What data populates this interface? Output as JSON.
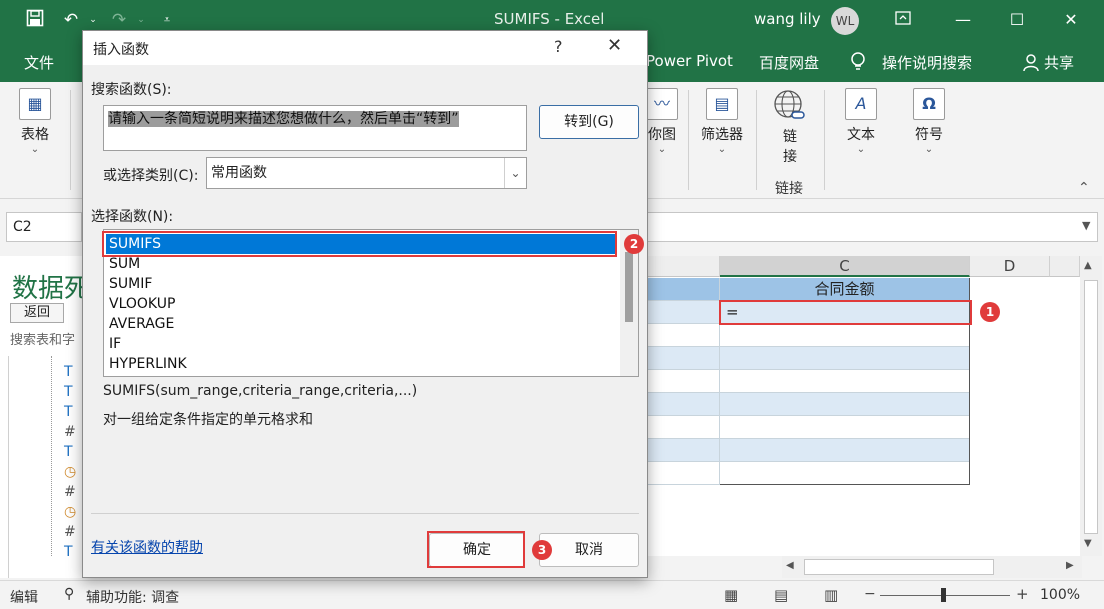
{
  "window": {
    "title": "SUMIFS  -  Excel",
    "user_name": "wang lily",
    "avatar_initials": "WL"
  },
  "ribbon_tabs": [
    {
      "label": "文件"
    },
    {
      "label": "Power Pivot"
    },
    {
      "label": "百度网盘"
    },
    {
      "label": "操作说明搜索"
    },
    {
      "label": "共享"
    }
  ],
  "ribbon": {
    "table_label": "表格",
    "chart_label": "你图",
    "filter_label": "筛选器",
    "link_label_1": "链",
    "link_label_2": "接",
    "link_group": "链接",
    "text_label": "文本",
    "symbol_label": "符号",
    "symbol_glyph": "Ω",
    "text_glyph": "A"
  },
  "formula_bar": {
    "name_box": "C2"
  },
  "sheet": {
    "col_c": "C",
    "col_d": "D",
    "header_c": "合同金额",
    "active_value": "="
  },
  "left_pane": {
    "title": "数据死",
    "back_label": "返回",
    "search_placeholder": "搜索表和字"
  },
  "status_bar": {
    "mode": "编辑",
    "accessibility": "辅助功能: 调查",
    "zoom": "100%"
  },
  "dialog": {
    "title": "插入函数",
    "help_glyph": "?",
    "close_glyph": "✕",
    "search_label": "搜索函数(S):",
    "search_text": "请输入一条简短说明来描述您想做什么，然后单击“转到”",
    "goto_label": "转到(G)",
    "category_label": "或选择类别(C):",
    "category_value": "常用函数",
    "func_label": "选择函数(N):",
    "functions": [
      "SUMIFS",
      "SUM",
      "SUMIF",
      "VLOOKUP",
      "AVERAGE",
      "IF",
      "HYPERLINK"
    ],
    "signature": "SUMIFS(sum_range,criteria_range,criteria,...)",
    "description": "对一组给定条件指定的单元格求和",
    "help_link": "有关该函数的帮助",
    "ok_label": "确定",
    "cancel_label": "取消"
  },
  "annotations": {
    "badge_1": "1",
    "badge_2": "2",
    "badge_3": "3",
    "color": "#e03b3b"
  }
}
